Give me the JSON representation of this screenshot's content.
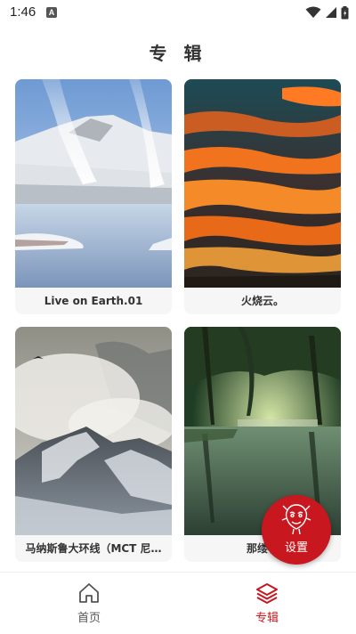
{
  "status_bar": {
    "time": "1:46",
    "notification_icon": "A"
  },
  "page": {
    "title": "专 辑"
  },
  "albums": [
    {
      "caption": "Live on Earth.01"
    },
    {
      "caption": "火烧云。"
    },
    {
      "caption": "马纳斯鲁大环线（MCT 尼…"
    },
    {
      "caption": "那缕春"
    }
  ],
  "fab": {
    "label": "设置",
    "color": "#c8171e"
  },
  "bottom_nav": {
    "items": [
      {
        "label": "首页",
        "icon": "home-icon",
        "active": false
      },
      {
        "label": "专辑",
        "icon": "layers-icon",
        "active": true
      }
    ],
    "active_color": "#c8171e",
    "inactive_color": "#555555"
  }
}
